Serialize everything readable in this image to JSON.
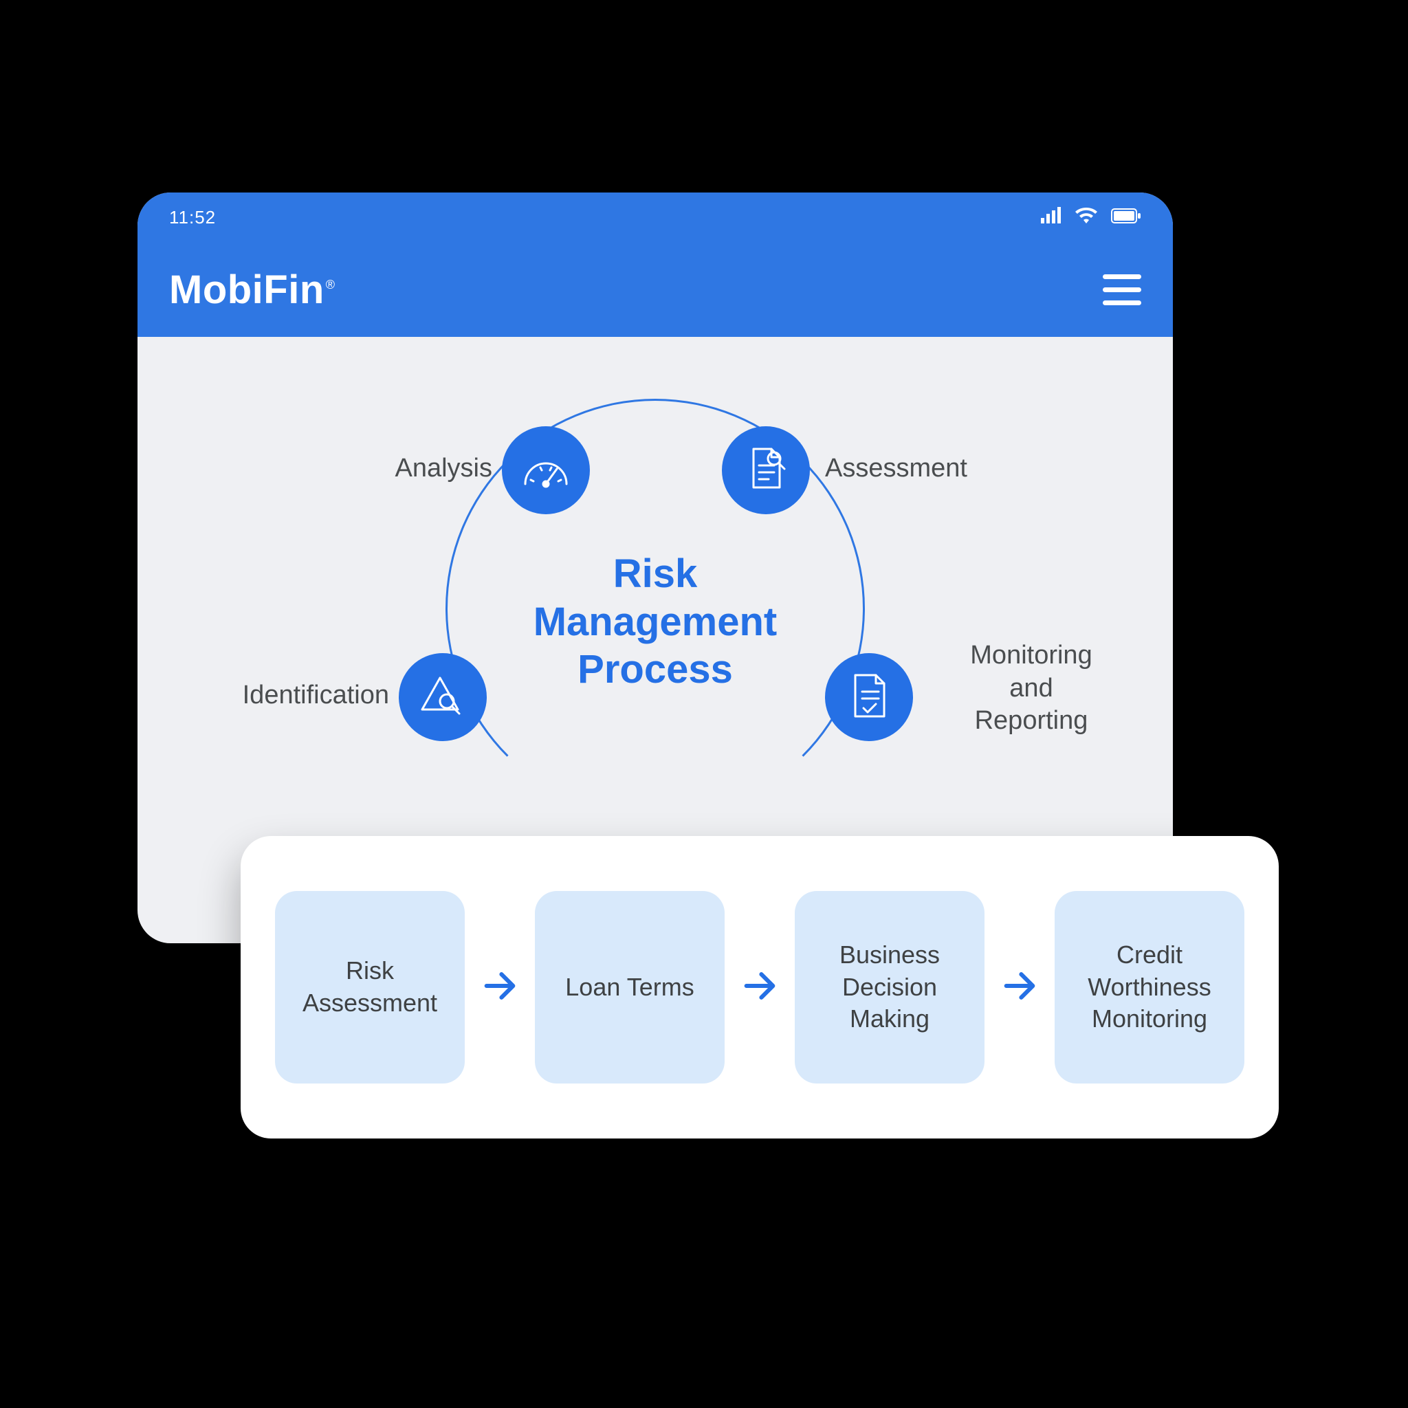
{
  "statusbar": {
    "time": "11:52"
  },
  "brand": {
    "name": "MobiFin",
    "mark": "®"
  },
  "diagram": {
    "title_line1": "Risk",
    "title_line2": "Management",
    "title_line3": "Process",
    "nodes": {
      "identification": "Identification",
      "analysis": "Analysis",
      "assessment": "Assessment",
      "monitoring": "Monitoring\nand\nReporting"
    }
  },
  "flow": {
    "steps": [
      "Risk Assessment",
      "Loan Terms",
      "Business Decision Making",
      "Credit Worthiness Monitoring"
    ]
  },
  "colors": {
    "primary": "#2F77E3",
    "accent": "#2570E5",
    "tile": "#D8E9FB",
    "text": "#4A4D4F"
  }
}
